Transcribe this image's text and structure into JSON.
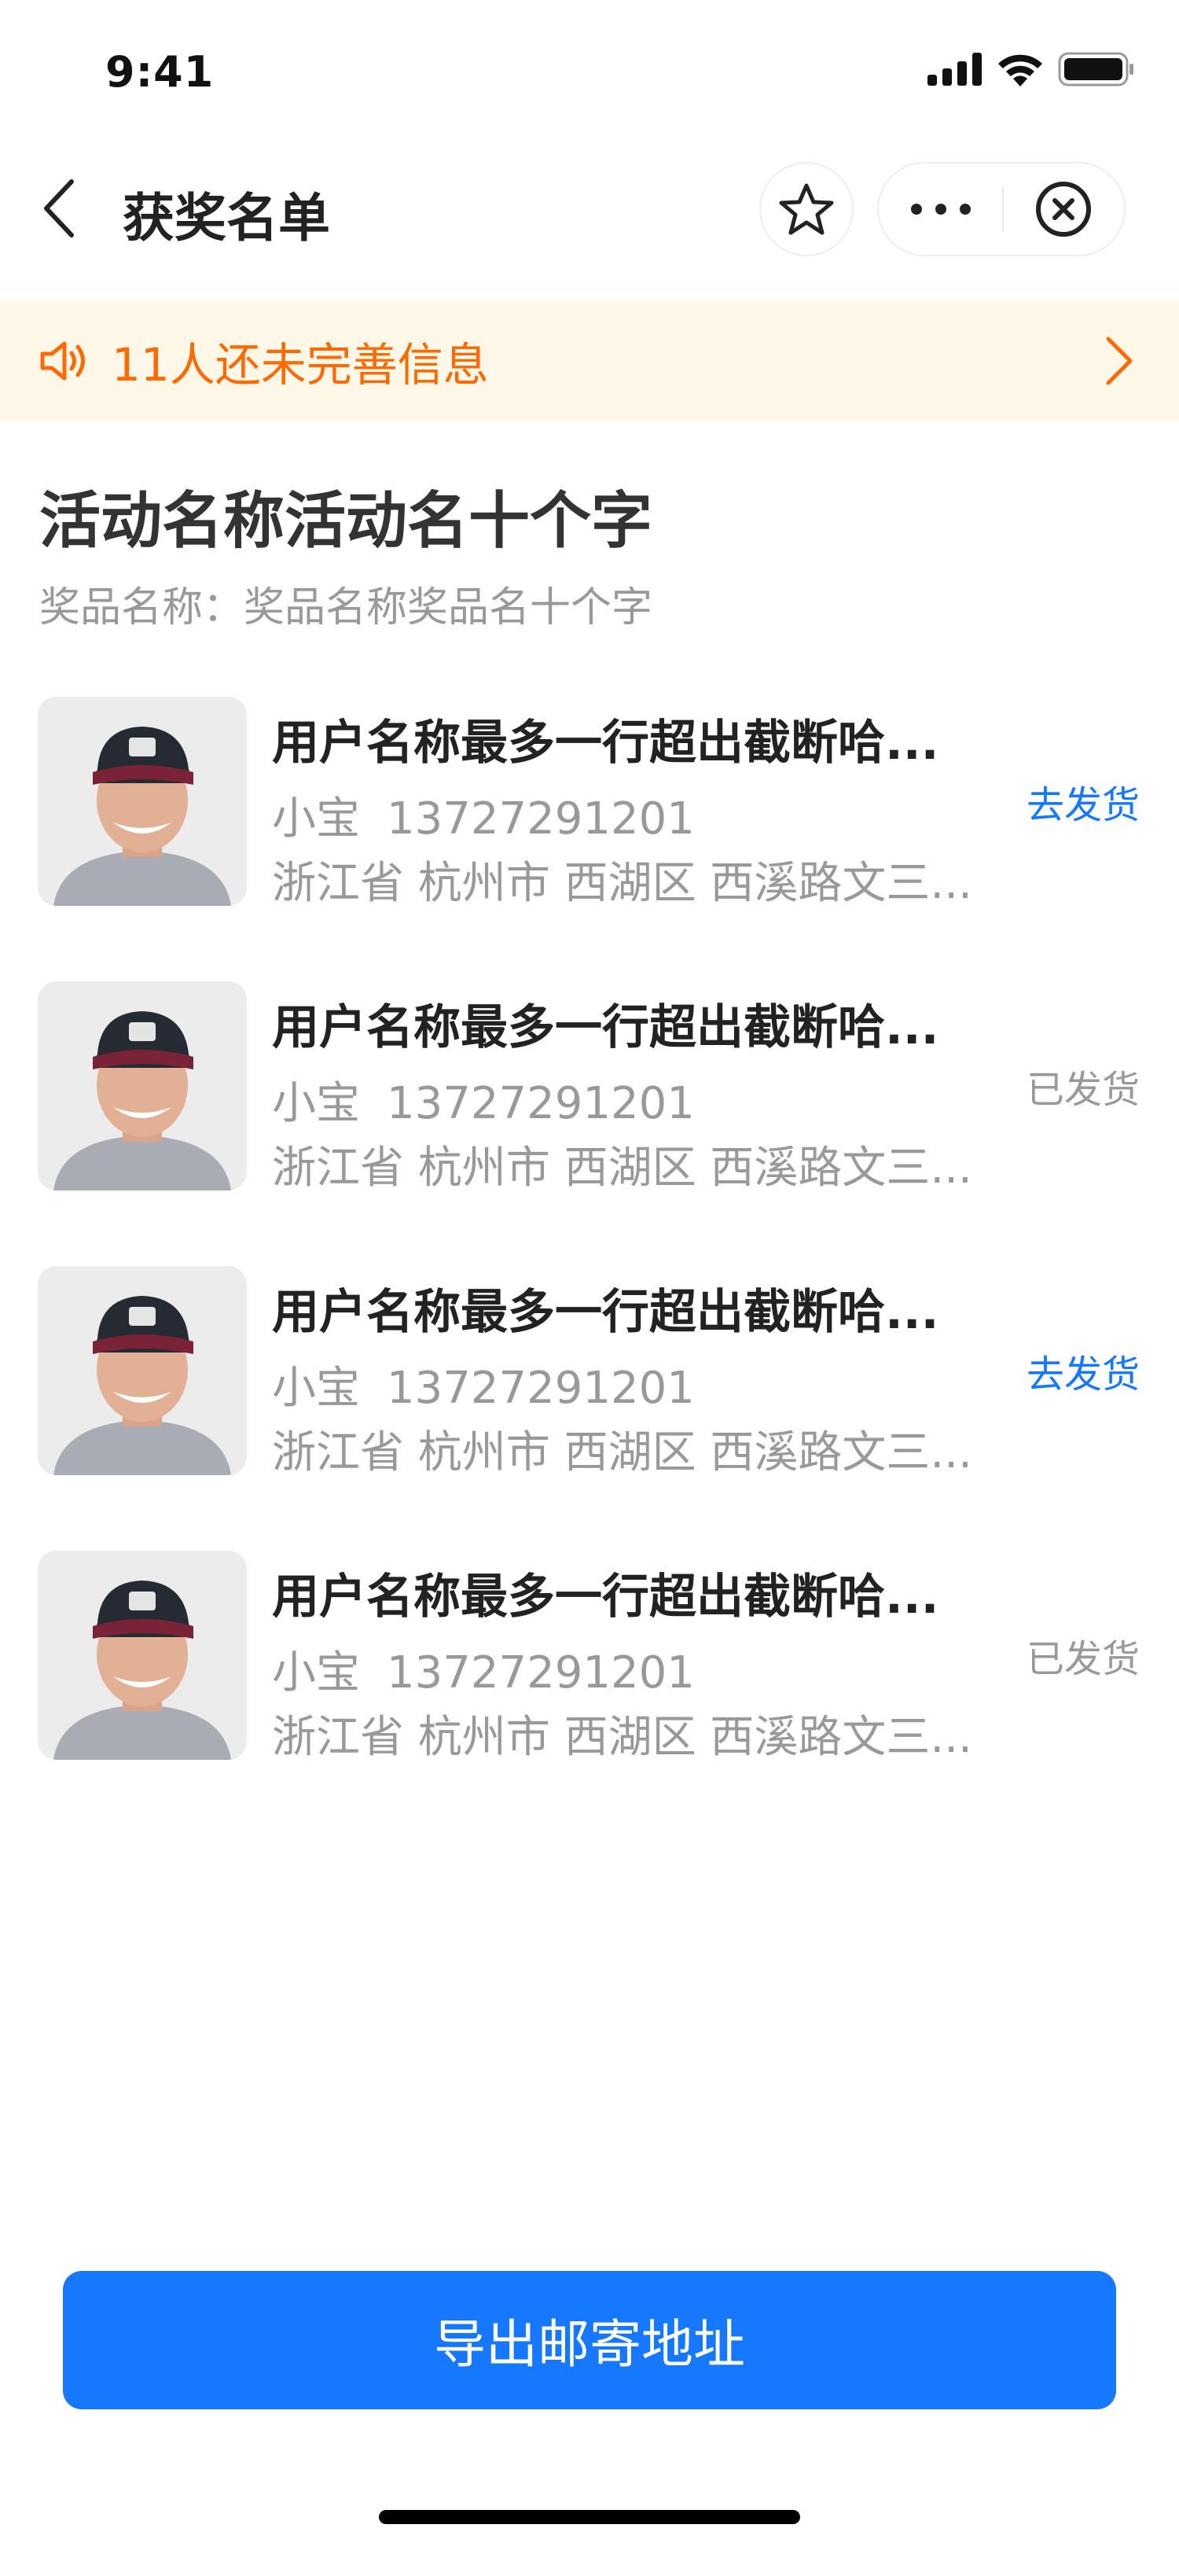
{
  "status_bar": {
    "time": "9:41",
    "icons": [
      "signal-icon",
      "wifi-icon",
      "battery-icon"
    ]
  },
  "nav": {
    "title": "获奖名单",
    "back_icon": "chevron-left-icon",
    "star_icon": "star-icon",
    "more_icon": "more-dots-icon",
    "close_icon": "close-circle-icon"
  },
  "notice": {
    "icon": "speaker-icon",
    "text": "11人还未完善信息",
    "arrow_icon": "chevron-right-icon",
    "color": "#ff6a00",
    "background": "#fff7e8"
  },
  "activity": {
    "title": "活动名称活动名十个字",
    "prize_label": "奖品名称：",
    "prize_name": "奖品名称奖品名十个字"
  },
  "winners": [
    {
      "name": "用户名称最多一行超出截断哈...",
      "contact": "小宝",
      "phone": "13727291201",
      "address": "浙江省 杭州市 西湖区 西溪路文三...",
      "status": "去发货",
      "status_type": "pending"
    },
    {
      "name": "用户名称最多一行超出截断哈...",
      "contact": "小宝",
      "phone": "13727291201",
      "address": "浙江省 杭州市 西湖区 西溪路文三...",
      "status": "已发货",
      "status_type": "done"
    },
    {
      "name": "用户名称最多一行超出截断哈...",
      "contact": "小宝",
      "phone": "13727291201",
      "address": "浙江省 杭州市 西湖区 西溪路文三...",
      "status": "去发货",
      "status_type": "pending"
    },
    {
      "name": "用户名称最多一行超出截断哈...",
      "contact": "小宝",
      "phone": "13727291201",
      "address": "浙江省 杭州市 西湖区 西溪路文三...",
      "status": "已发货",
      "status_type": "done"
    }
  ],
  "export_button": {
    "label": "导出邮寄地址",
    "color": "#1677ff"
  }
}
